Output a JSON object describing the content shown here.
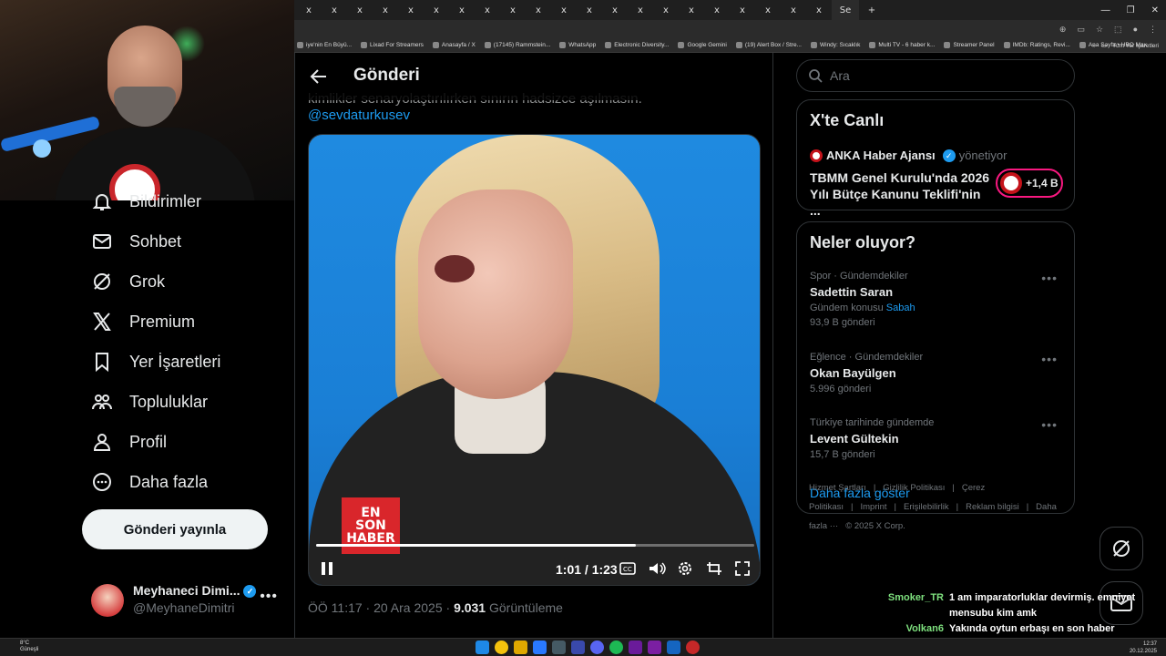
{
  "browser": {
    "tabs": [
      "x",
      "x",
      "x",
      "x",
      "x",
      "x",
      "x",
      "x",
      "x",
      "x",
      "x",
      "x",
      "x",
      "x",
      "x",
      "x",
      "x",
      "x",
      "x",
      "x",
      "x"
    ],
    "active_tab": "Se",
    "new_tab": "+",
    "bookmarks": [
      "iye'nin En Büyü...",
      "Lixad For Streamers",
      "Anasayfa / X",
      "(17145) Rammstein...",
      "WhatsApp",
      "Electronic Diversity...",
      "Google Gemini",
      "(19) Alert Box / Stre...",
      "Windy: Sıcaklık",
      "Multi TV - 6 haber k...",
      "Streamer Panel",
      "IMDb: Ratings, Revi...",
      "Ana Sayfa • HBO Max"
    ],
    "bookmark_more": "»",
    "all_bookmarks": "Tüm Yer İşaretleri"
  },
  "nav": {
    "items": [
      {
        "label": "Bildirimler",
        "icon": "bell-icon"
      },
      {
        "label": "Sohbet",
        "icon": "mail-icon"
      },
      {
        "label": "Grok",
        "icon": "grok-icon"
      },
      {
        "label": "Premium",
        "icon": "x-logo-icon"
      },
      {
        "label": "Yer İşaretleri",
        "icon": "bookmark-icon"
      },
      {
        "label": "Topluluklar",
        "icon": "communities-icon"
      },
      {
        "label": "Profil",
        "icon": "person-icon"
      },
      {
        "label": "Daha fazla",
        "icon": "more-circle-icon"
      }
    ],
    "post_button": "Gönderi yayınla",
    "profile": {
      "name": "Meyhaneci Dimi...",
      "handle": "@MeyhaneDimitri",
      "more": "•••"
    }
  },
  "post": {
    "header_title": "Gönderi",
    "cut_text": "kimlikler senaryolaştırılırken sınırın hadsizce aşılmasın.",
    "mention": "@sevdaturkusev",
    "video": {
      "logo_lines": [
        "EN",
        "SON",
        "HABER"
      ],
      "time": "1:01 / 1:23",
      "progress_fraction": 0.73
    },
    "meta_time": "ÖÖ 11:17 · 20 Ara 2025 · ",
    "meta_views": "9.031",
    "meta_views_label": " Görüntüleme"
  },
  "sidebar": {
    "search_placeholder": "Ara",
    "live": {
      "heading": "X'te Canlı",
      "source": "ANKA Haber Ajansı",
      "role": "yönetiyor",
      "title": "TBMM Genel Kurulu'nda 2026 Yılı Bütçe Kanunu Teklifi'nin ...",
      "listeners": "+1,4 B"
    },
    "trends": {
      "heading": "Neler oluyor?",
      "items": [
        {
          "context": "Spor · Gündemdekiler",
          "title": "Sadettin Saran",
          "sub_prefix": "Gündem konusu ",
          "sub_link": "Sabah",
          "count": "93,9 B gönderi"
        },
        {
          "context": "Eğlence · Gündemdekiler",
          "title": "Okan Bayülgen",
          "count": "5.996 gönderi"
        },
        {
          "context": "Türkiye tarihinde gündemde",
          "title": "Levent Gültekin",
          "count": "15,7 B gönderi"
        }
      ],
      "more_label": "•••",
      "show_more": "Daha fazla göster"
    },
    "footer": [
      "Hizmet Şartları",
      "|",
      "Gizlilik Politikası",
      "|",
      "Çerez Politikası",
      "|",
      "Imprint",
      "|",
      "Erişilebilirlik",
      "|",
      "Reklam bilgisi",
      "|",
      "Daha fazla ···",
      "© 2025 X Corp."
    ]
  },
  "chat": [
    {
      "user": "Smoker_TR",
      "text": "1 am imparatorluklar devirmiş. emniyet mensubu kim amk"
    },
    {
      "user": "Volkan6",
      "text": "Yakında oytun erbaşı en son haber kadrosuna katıp bu şekil video çektirmezse şaşırmam"
    }
  ],
  "taskbar": {
    "weather_temp": "8°C",
    "weather_desc": "Güneşli",
    "time": "12:37",
    "date": "20.12.2025"
  },
  "colors": {
    "accent": "#1d9bf0",
    "live_pink": "#f91880",
    "chat_user": "#7ee07e"
  }
}
